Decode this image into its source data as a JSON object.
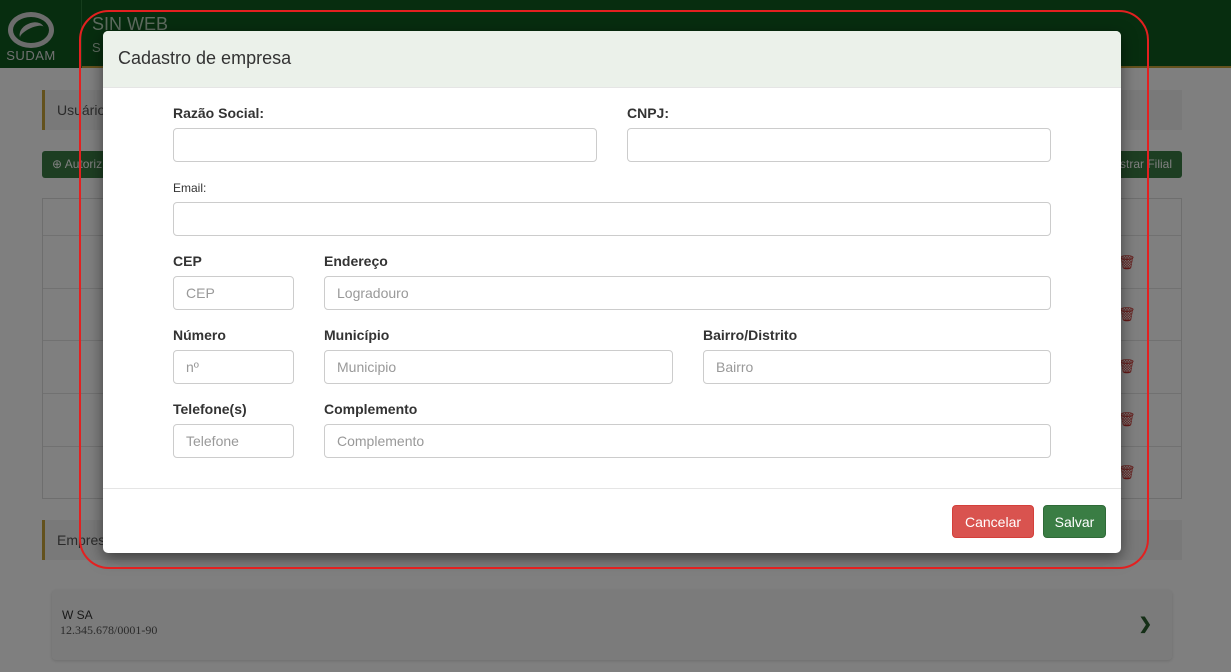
{
  "app": {
    "logo_text": "SUDAM",
    "title": "SIN WEB",
    "subtitle": "S"
  },
  "background": {
    "user_panel_label": "Usuário",
    "authorize_button": "Autoriz",
    "add_branch_button": "strar Filial",
    "companies_panel_label": "Empres",
    "company_card": {
      "name": "W   SA",
      "cnpj": "12.345.678/0001-90"
    }
  },
  "modal": {
    "title": "Cadastro de empresa",
    "fields": {
      "razao_social": {
        "label": "Razão Social:",
        "value": "",
        "placeholder": ""
      },
      "cnpj": {
        "label": "CNPJ:",
        "value": "",
        "placeholder": ""
      },
      "email": {
        "label": "Email:",
        "value": "",
        "placeholder": ""
      },
      "cep": {
        "label": "CEP",
        "value": "",
        "placeholder": "CEP"
      },
      "endereco": {
        "label": "Endereço",
        "value": "",
        "placeholder": "Logradouro"
      },
      "numero": {
        "label": "Número",
        "value": "",
        "placeholder": "nº"
      },
      "municipio": {
        "label": "Município",
        "value": "",
        "placeholder": "Municipio"
      },
      "bairro": {
        "label": "Bairro/Distrito",
        "value": "",
        "placeholder": "Bairro"
      },
      "telefone": {
        "label": "Telefone(s)",
        "value": "",
        "placeholder": "Telefone"
      },
      "complemento": {
        "label": "Complemento",
        "value": "",
        "placeholder": "Complemento"
      }
    },
    "buttons": {
      "cancel": "Cancelar",
      "save": "Salvar"
    }
  },
  "colors": {
    "brand_green": "#0e5a1f",
    "accent_gold": "#c7a33a",
    "save_green": "#3a7d44",
    "cancel_red": "#d9534f",
    "annotation_red": "#e32020"
  }
}
